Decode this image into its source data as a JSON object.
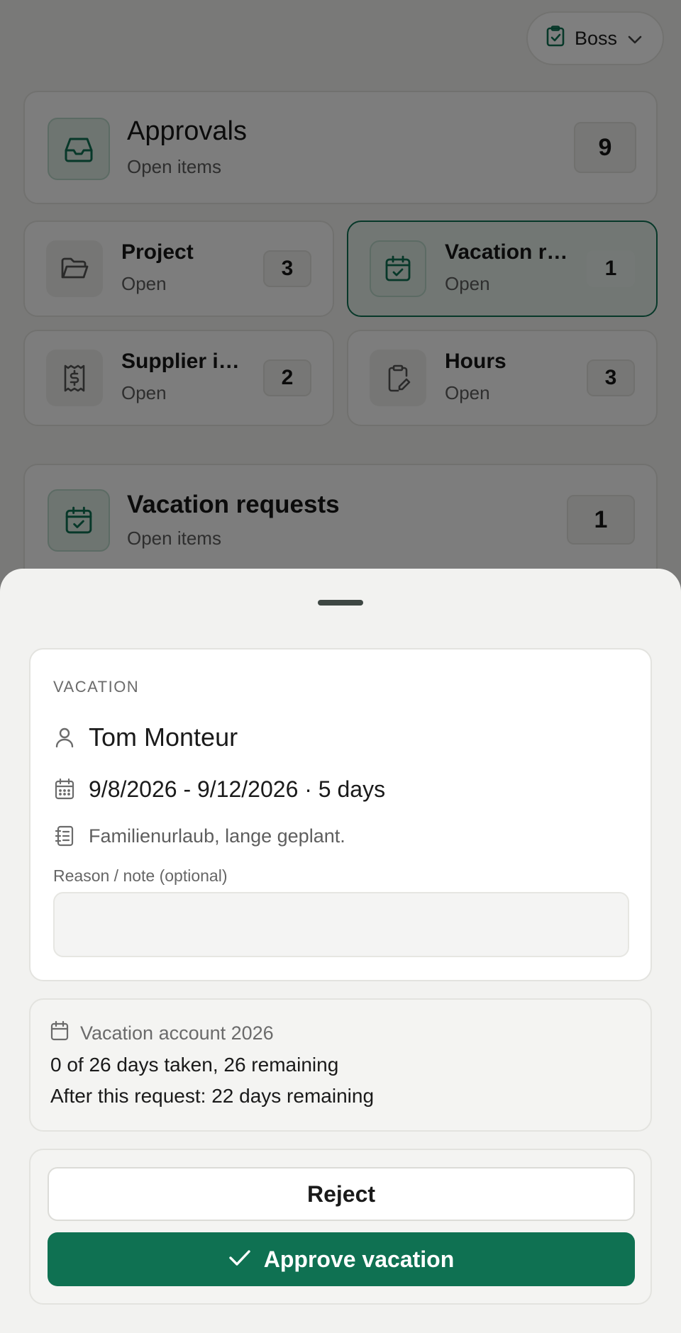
{
  "role": {
    "label": "Boss"
  },
  "approvals": {
    "title": "Approvals",
    "subtitle": "Open items",
    "count": "9"
  },
  "categories": [
    {
      "title": "Project",
      "subtitle": "Open",
      "count": "3"
    },
    {
      "title": "Vacation requests",
      "subtitle": "Open",
      "count": "1"
    },
    {
      "title": "Supplier invoices",
      "subtitle": "Open",
      "count": "2"
    },
    {
      "title": "Hours",
      "subtitle": "Open",
      "count": "3"
    }
  ],
  "section": {
    "title": "Vacation requests",
    "subtitle": "Open items",
    "count": "1"
  },
  "request": {
    "kicker": "VACATION",
    "employee": "Tom Monteur",
    "dates": "9/8/2026 - 9/12/2026 · 5 days",
    "note": "Familienurlaub, lange geplant.",
    "reason_label": "Reason / note (optional)",
    "reason_value": "",
    "reason_placeholder": ""
  },
  "account": {
    "title": "Vacation account 2026",
    "taken": "0 of 26 days taken, 26 remaining",
    "after": "After this request: 22 days remaining"
  },
  "actions": {
    "reject": "Reject",
    "approve": "Approve vacation"
  },
  "colors": {
    "brand": "#0f7152",
    "overlay": "rgba(0,0,0,0.5)"
  },
  "icons": [
    "clipboard-check-icon",
    "chevron-down-icon",
    "inbox-icon",
    "folder-icon",
    "calendar-check-icon",
    "receipt-icon",
    "clipboard-edit-icon",
    "user-icon",
    "calendar-icon",
    "notebook-icon",
    "check-icon"
  ]
}
